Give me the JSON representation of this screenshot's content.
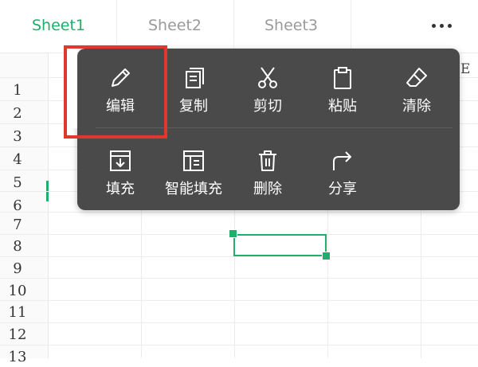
{
  "tabs": [
    "Sheet1",
    "Sheet2",
    "Sheet3"
  ],
  "active_tab": "Sheet1",
  "row_numbers": [
    "1",
    "2",
    "3",
    "4",
    "5",
    "6",
    "7",
    "8",
    "9",
    "10",
    "11",
    "12",
    "13"
  ],
  "column_header_partial": "E",
  "context_menu": {
    "row1": [
      "编辑",
      "复制",
      "剪切",
      "粘贴",
      "清除"
    ],
    "row2": [
      "填充",
      "智能填充",
      "删除",
      "分享"
    ]
  },
  "icons": {
    "edit": "pencil-icon",
    "copy": "copy-icon",
    "cut": "scissors-icon",
    "paste": "clipboard-icon",
    "clear": "eraser-icon",
    "fill": "fill-down-icon",
    "smart_fill": "smart-fill-icon",
    "delete": "trash-icon",
    "share": "share-icon"
  },
  "colors": {
    "accent": "#1fae6b",
    "menu_bg": "#4a4a4a",
    "highlight": "#e0382c"
  }
}
